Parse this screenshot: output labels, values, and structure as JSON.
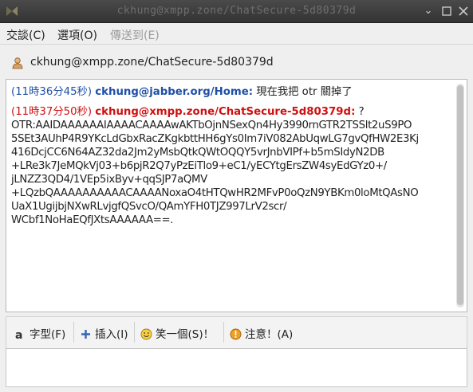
{
  "window": {
    "title": "ckhung@xmpp.zone/ChatSecure-5d80379d"
  },
  "menu": {
    "items": [
      {
        "label": "交談(C)",
        "disabled": false
      },
      {
        "label": "選項(O)",
        "disabled": false
      },
      {
        "label": "傳送到(E)",
        "disabled": true
      }
    ]
  },
  "conversation": {
    "contact": "ckhung@xmpp.zone/ChatSecure-5d80379d",
    "messages": [
      {
        "timestamp": "(11時36分45秒)",
        "sender": "ckhung@jabber.org/Home:",
        "text": "現在我把 otr 關掉了"
      },
      {
        "timestamp": "(11時37分50秒)",
        "sender": "ckhung@xmpp.zone/ChatSecure-5d80379d:",
        "text": "?",
        "body_lines": [
          "OTR:AAIDAAAAAAIAAAACAAAAwAKTbOjnNSexQn4Hy3990rnGTR2TSSlt2uS9PO",
          "5SEt3AUhP4R9YKcLdGbxRacZKgkbttHH6gYs0Im7iV082AbUqwLG7gvQfHW2E3Kj",
          "416DcjCC6N64AZ32da2Jm2yMsbQtkQWtOQQY5vrJnbVIPf+b5mSIdyN2DB",
          "+LRe3k7JeMQkVj03+b6pjR2Q7yPzEiTlo9+eC1/yECYtgErsZW4syEdGYz0+/",
          "jLNZZ3QD4/1VEp5ixByv+qqSJP7aQMV",
          "+LQzbQAAAAAAAAAACAAAANoxaO4tHTQwHR2MFvP0oQzN9YBKm0loMtQAsNO",
          "UaX1UgijbjNXwRLvjgfQSvcO/QAmYFH0TJZ997LrV2scr/",
          "WCbf1NoHaEQfJXtsAAAAAA==."
        ]
      }
    ]
  },
  "toolbar": {
    "font_label": "字型(F)",
    "insert_label": "插入(I)",
    "smile_label": "笑一個(S)！",
    "attention_label": "注意！(A)"
  },
  "colors": {
    "own_nick": "#1f4fa8",
    "remote_nick": "#d01010",
    "titlebar": "#3a3a3a"
  },
  "icons": {
    "app": "pidgin-icon",
    "contact": "person-icon",
    "font": "font-icon",
    "insert": "plus-icon",
    "smile": "smiley-icon",
    "attention": "warning-icon"
  }
}
